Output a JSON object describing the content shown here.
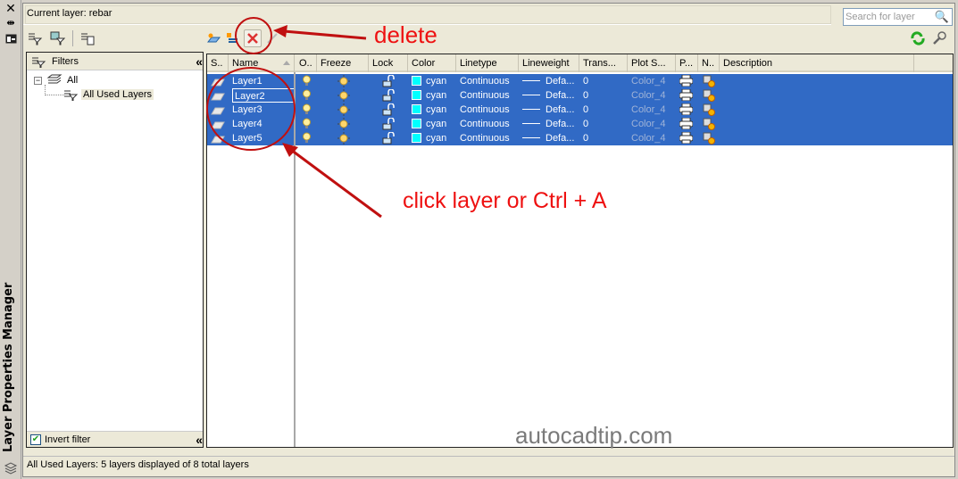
{
  "palette": {
    "selection_blue": "#316ac5",
    "annotation_red": "#ee1111",
    "swatch_cyan": "#00ffff"
  },
  "side_strip": {
    "title": "Layer Properties Manager",
    "icons": [
      "close-icon",
      "auto-hide-icon",
      "properties-icon",
      "layers-icon"
    ]
  },
  "header": {
    "current_layer": "Current layer: rebar",
    "search_placeholder": "Search for layer"
  },
  "toolbar_left": [
    "new-property-filter-icon",
    "new-group-filter-icon",
    "layer-states-manager-icon"
  ],
  "toolbar_right": [
    "new-layer-icon",
    "new-layer-vp-frozen-icon",
    "delete-layer-icon",
    "set-current-icon"
  ],
  "toolbar_far_right": [
    "refresh-icon",
    "settings-icon"
  ],
  "filters": {
    "title": "Filters",
    "tree": [
      {
        "label": "All",
        "expanded": true
      },
      {
        "label": "All Used Layers",
        "selected": true
      }
    ],
    "invert_filter_label": "Invert filter",
    "invert_filter_checked": true
  },
  "grid": {
    "columns": [
      "S..",
      "Name",
      "O..",
      "Freeze",
      "Lock",
      "Color",
      "Linetype",
      "Lineweight",
      "Trans...",
      "Plot S...",
      "P...",
      "N..",
      "Description"
    ],
    "rows": [
      {
        "name": "Layer1",
        "color": "cyan",
        "linetype": "Continuous",
        "lineweight": "Defa...",
        "transparency": "0",
        "plot_style": "Color_4"
      },
      {
        "name": "Layer2",
        "color": "cyan",
        "linetype": "Continuous",
        "lineweight": "Defa...",
        "transparency": "0",
        "plot_style": "Color_4",
        "focused": true
      },
      {
        "name": "Layer3",
        "color": "cyan",
        "linetype": "Continuous",
        "lineweight": "Defa...",
        "transparency": "0",
        "plot_style": "Color_4"
      },
      {
        "name": "Layer4",
        "color": "cyan",
        "linetype": "Continuous",
        "lineweight": "Defa...",
        "transparency": "0",
        "plot_style": "Color_4"
      },
      {
        "name": "Layer5",
        "color": "cyan",
        "linetype": "Continuous",
        "lineweight": "Defa...",
        "transparency": "0",
        "plot_style": "Color_4"
      }
    ]
  },
  "status_bar": "All Used Layers: 5 layers displayed of 8 total layers",
  "annotations": {
    "delete": "delete",
    "select": "click layer or Ctrl + A",
    "watermark": "autocadtip.com"
  }
}
